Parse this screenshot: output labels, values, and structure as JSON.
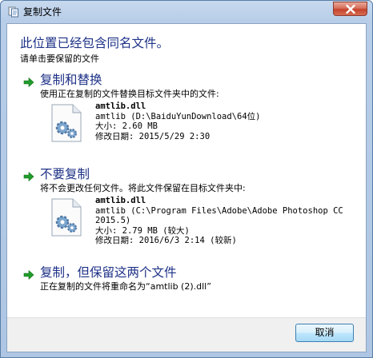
{
  "window": {
    "title": "复制文件"
  },
  "heading": "此位置已经包含同名文件。",
  "subheading": "请单击要保留的文件",
  "options": [
    {
      "title": "复制和替换",
      "desc": "使用正在复制的文件替换目标文件夹中的文件:",
      "file": {
        "name": "amtlib.dll",
        "path": "amtlib (D:\\BaiduYunDownload\\64位)",
        "size": "大小: 2.60 MB",
        "modified": "修改日期: 2015/5/29 2:30"
      }
    },
    {
      "title": "不要复制",
      "desc": "将不会更改任何文件。将此文件保留在目标文件夹中:",
      "file": {
        "name": "amtlib.dll",
        "path": "amtlib (C:\\Program Files\\Adobe\\Adobe Photoshop CC 2015.5)",
        "size": "大小: 2.79 MB (较大)",
        "modified": "修改日期: 2016/6/3 2:14 (较新)"
      }
    },
    {
      "title": "复制，但保留这两个文件",
      "desc": "正在复制的文件将重命名为“amtlib (2).dll”"
    }
  ],
  "footer": {
    "cancel_label": "取消"
  },
  "icons": {
    "arrow": "green-arrow-icon",
    "file": "dll-gear-file-icon",
    "close": "close-icon"
  },
  "colors": {
    "title_blue": "#1e3287",
    "arrow_green": "#1f9c2a",
    "close_red": "#c4432c"
  }
}
